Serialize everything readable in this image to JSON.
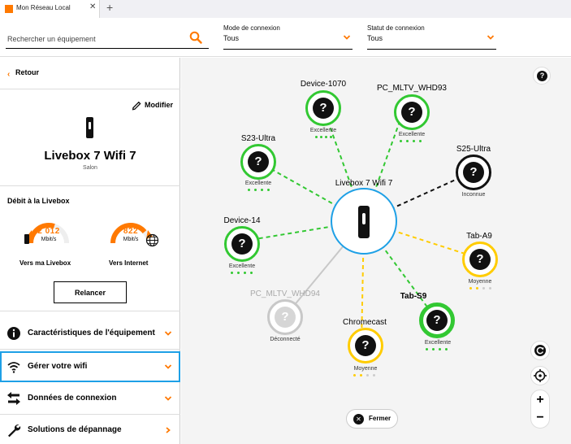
{
  "browser": {
    "tab_title": "Mon Réseau Local",
    "tab_close": "✕",
    "new_tab": "+"
  },
  "filters": {
    "search_placeholder": "Rechercher un équipement",
    "mode": {
      "label": "Mode de connexion",
      "value": "Tous"
    },
    "statut": {
      "label": "Statut de connexion",
      "value": "Tous"
    }
  },
  "panel": {
    "back_label": "Retour",
    "modify_label": "Modifier",
    "device_name": "Livebox 7 Wifi 7",
    "device_location": "Salon",
    "debit_title": "Débit à la Livebox",
    "gauge_local": {
      "value": "2 012",
      "unit": "Mbit/s",
      "label": "Vers ma Livebox",
      "level": 0.6
    },
    "gauge_internet": {
      "value": "822",
      "unit": "Mbit/s",
      "label": "Vers Internet",
      "level": 0.78
    },
    "relancer_label": "Relancer",
    "menu": [
      {
        "label": "Caractéristiques de l'équipement",
        "icon": "info-icon"
      },
      {
        "label": "Gérer votre wifi",
        "icon": "wifi-icon"
      },
      {
        "label": "Données de connexion",
        "icon": "transfer-arrows-icon"
      },
      {
        "label": "Solutions de dépannage",
        "icon": "wrench-icon"
      }
    ]
  },
  "map": {
    "hub_name": "Livebox 7 Wifi 7",
    "close_label": "Fermer",
    "colors": {
      "excellent": "#32c832",
      "moyenne": "#ffcc00",
      "inconnue": "#111111",
      "deconnecte": "#c8c8c8",
      "hub": "#1ea0e6",
      "accent": "#ff7900"
    },
    "devices": [
      {
        "name": "Device-1070",
        "status": "Excellente",
        "quality": "excellent",
        "signal": 4
      },
      {
        "name": "PC_MLTV_WHD93",
        "status": "Excellente",
        "quality": "excellent",
        "signal": 4
      },
      {
        "name": "S23-Ultra",
        "status": "Excellente",
        "quality": "excellent",
        "signal": 4
      },
      {
        "name": "S25-Ultra",
        "status": "Inconnue",
        "quality": "inconnue",
        "signal": 0
      },
      {
        "name": "Device-14",
        "status": "Excellente",
        "quality": "excellent",
        "signal": 4
      },
      {
        "name": "Tab-A9",
        "status": "Moyenne",
        "quality": "moyenne",
        "signal": 2
      },
      {
        "name": "PC_MLTV_WHD94",
        "status": "Déconnecté",
        "quality": "deconnecte",
        "signal": 0
      },
      {
        "name": "Tab-S9",
        "status": "Excellente",
        "quality": "excellent",
        "signal": 4
      },
      {
        "name": "Chromecast",
        "status": "Moyenne",
        "quality": "moyenne",
        "signal": 2
      }
    ]
  }
}
